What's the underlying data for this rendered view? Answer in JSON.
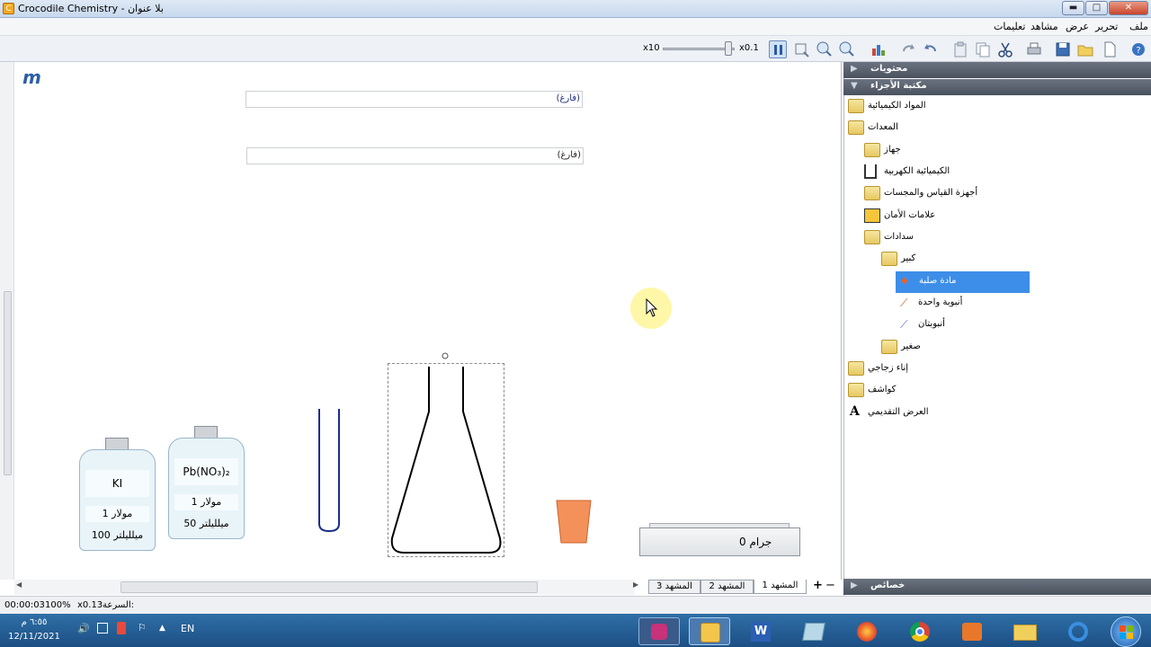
{
  "window": {
    "title": "Crocodile Chemistry - بلا عنوان",
    "app_icon": "C",
    "minimize": "▬",
    "maximize": "□",
    "close": "✕"
  },
  "menu": {
    "file": "ملف",
    "edit": "تحرير",
    "view": "عرض",
    "scenes": "مشاهد",
    "help": "تعليمات"
  },
  "toolbar": {
    "speed_min": "x10",
    "speed_max": "x0.1"
  },
  "canvas": {
    "logo": "m",
    "empty_label_1": "(فارغ)",
    "empty_label_2": "(فارغ)",
    "bottle1": {
      "name": "KI",
      "molarity": "1 مولار",
      "volume": "100 ميلليلتر"
    },
    "bottle2": {
      "name": "Pb(NO₃)₂",
      "molarity": "1 مولار",
      "volume": "50 ميلليلتر"
    },
    "scale_reading": "0 جرام"
  },
  "sidebar": {
    "contents": "محتويات",
    "parts_library": "مكتبة الأجزاء",
    "properties": "خصائص",
    "tree": {
      "chemicals": "المواد الكيميائية",
      "equipment": "المعدات",
      "device": "جهاز",
      "electrochem": "الكيميائية الكهربية",
      "measuring": "أجهزة القياس والمجسات",
      "safety": "علامات الأمان",
      "stoppers": "سدادات",
      "large": "كبير",
      "solid": "مادة صلبة",
      "one_tube": "أنبوبة واحدة",
      "two_tubes": "أنبوبتان",
      "small": "صغير",
      "glassware": "إناء زجاجي",
      "indicators": "كواشف",
      "presentation": "العرض التقديمي"
    }
  },
  "scenes": {
    "add": "+",
    "remove": "−",
    "scene1": "المشهد 1",
    "scene2": "المشهد 2",
    "scene3": "المشهد 3"
  },
  "status": {
    "time": "00:00:03",
    "zoom": "100%",
    "speed_label": "السرعة:",
    "speed_value": "x0.13"
  },
  "taskbar": {
    "clock": "٦:٥٥ م",
    "date": "12/11/2021",
    "lang": "EN"
  },
  "colors": {
    "selection": "#3d8ee8",
    "beaker_orange": "#f4915a",
    "cursor_highlight": "#fff7a8"
  }
}
